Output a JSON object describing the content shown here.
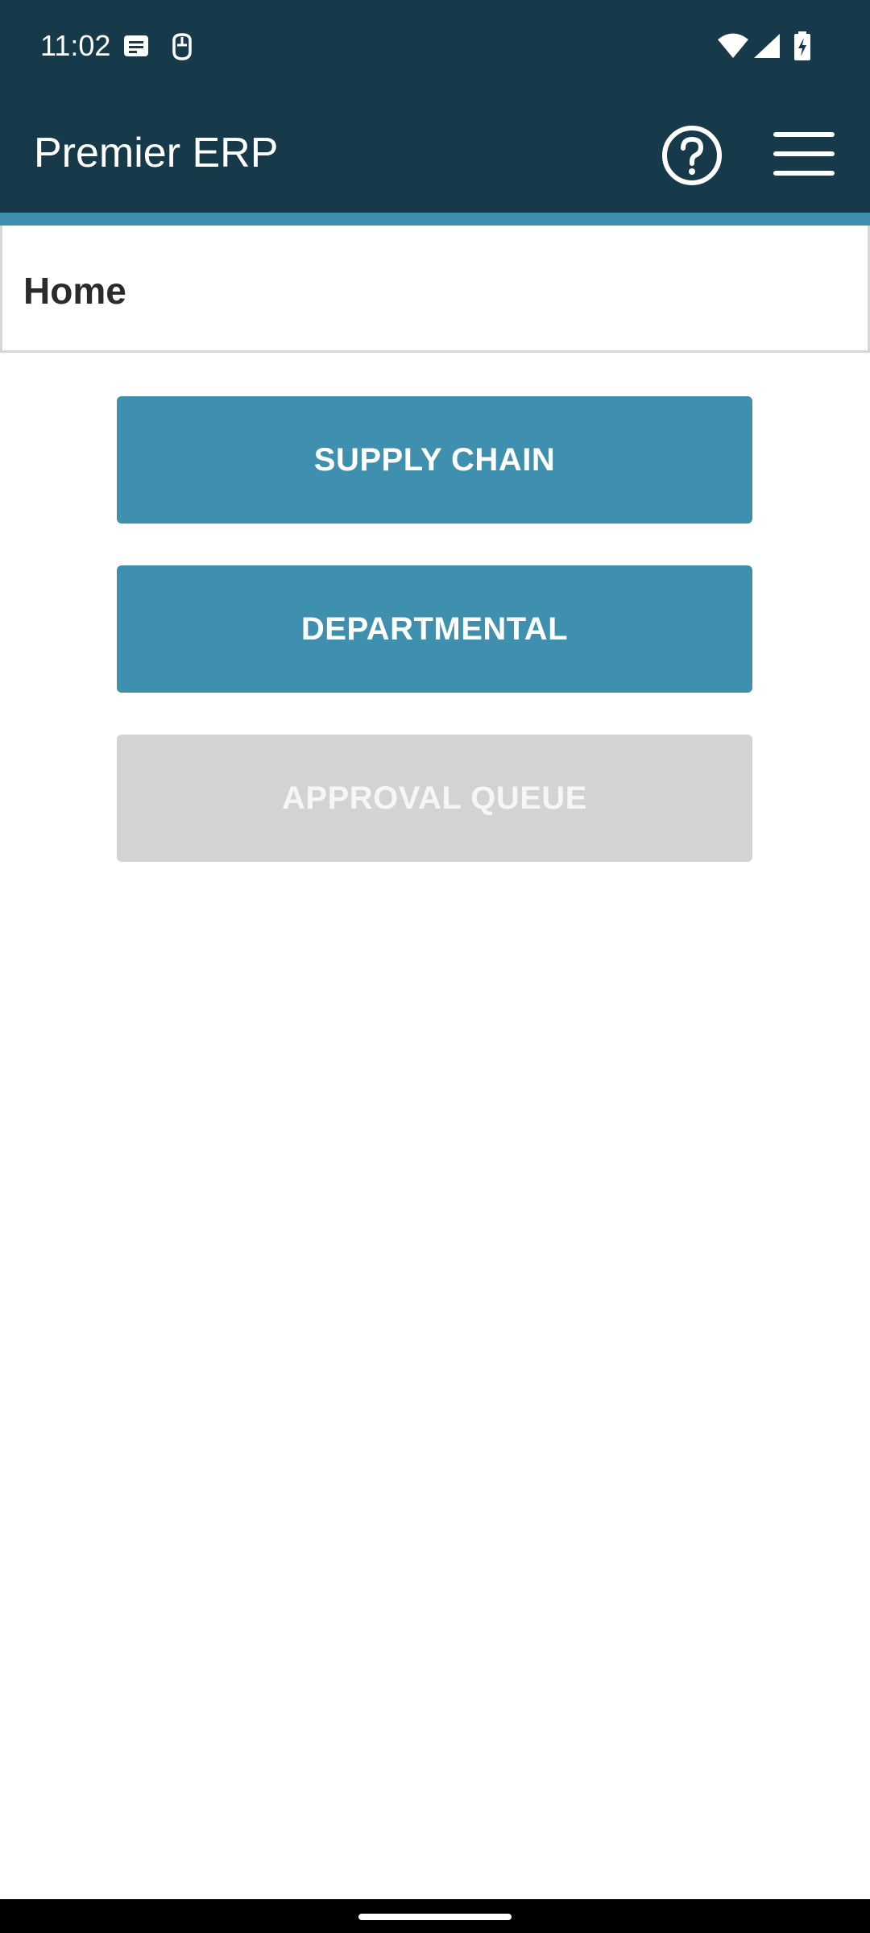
{
  "status_bar": {
    "time": "11:02",
    "icons": [
      "message-icon",
      "notification-icon",
      "wifi-icon",
      "signal-icon",
      "battery-charging-icon"
    ]
  },
  "app_bar": {
    "title": "Premier ERP",
    "help_icon": "help-circle-icon",
    "menu_icon": "hamburger-menu-icon"
  },
  "breadcrumb": {
    "title": "Home"
  },
  "menu_buttons": [
    {
      "label": "SUPPLY CHAIN",
      "state": "enabled"
    },
    {
      "label": "DEPARTMENTAL",
      "state": "enabled"
    },
    {
      "label": "APPROVAL QUEUE",
      "state": "disabled"
    }
  ],
  "colors": {
    "header_bg": "#173a4b",
    "accent": "#3f8fae",
    "button_primary": "#3f8fae",
    "button_disabled": "#d3d3d3",
    "text_dark": "#2b2b2b"
  }
}
